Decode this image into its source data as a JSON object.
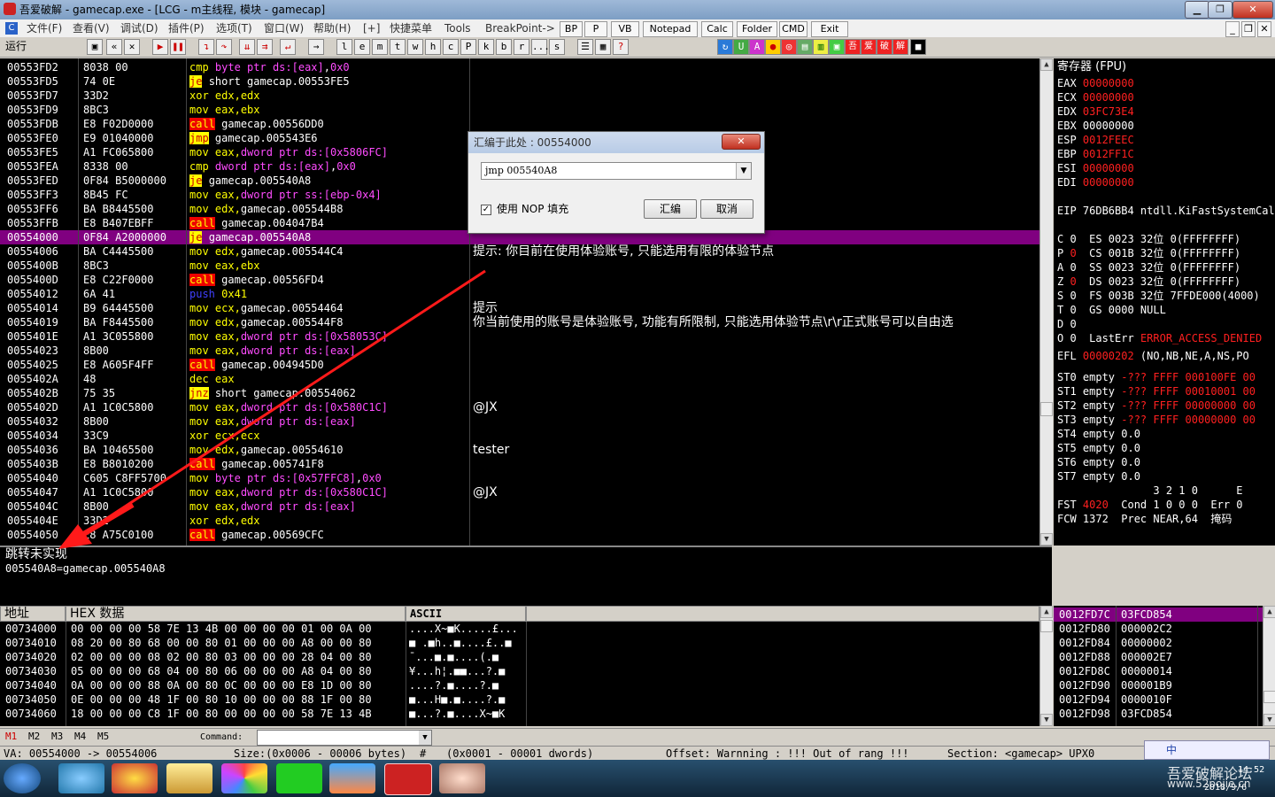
{
  "window": {
    "title": "吾爱破解 - gamecap.exe - [LCG - m主线程, 模块 - gamecap]",
    "minimize": "▁",
    "restore": "❐",
    "close": "✕"
  },
  "menu": {
    "items": [
      "文件(F)",
      "查看(V)",
      "调试(D)",
      "插件(P)",
      "选项(T)",
      "窗口(W)",
      "帮助(H)",
      "[+]",
      "快捷菜单",
      "Tools",
      "BreakPoint->"
    ],
    "buttons": [
      "BP",
      "P",
      "VB",
      "Notepad",
      "Calc",
      "Folder",
      "CMD",
      "Exit"
    ],
    "right_min": "_",
    "right_restore": "❐",
    "right_close": "✕"
  },
  "toolbar": {
    "status": "运行",
    "letters": [
      "l",
      "e",
      "m",
      "t",
      "w",
      "h",
      "c",
      "P",
      "k",
      "b",
      "r",
      "...",
      "s"
    ]
  },
  "disasm": {
    "selected_index": 12,
    "rows": [
      {
        "addr": "00553FD2",
        "hex": "8038 00",
        "mn": "cmp",
        "op": [
          [
            "byte ptr ds:[eax]",
            "mag"
          ],
          [
            ",",
            ""
          ],
          [
            "0x0",
            "imm"
          ]
        ]
      },
      {
        "addr": "00553FD5",
        "hex": "74 0E",
        "mn": "je",
        "op": [
          [
            "short gamecap.00553FE5",
            ""
          ]
        ]
      },
      {
        "addr": "00553FD7",
        "hex": "33D2",
        "mn": "xor",
        "op": [
          [
            "edx,edx",
            "kw"
          ]
        ]
      },
      {
        "addr": "00553FD9",
        "hex": "8BC3",
        "mn": "mov",
        "op": [
          [
            "eax,ebx",
            "kw"
          ]
        ]
      },
      {
        "addr": "00553FDB",
        "hex": "E8 F02D0000",
        "mn": "call",
        "op": [
          [
            "gamecap.00556DD0",
            ""
          ]
        ]
      },
      {
        "addr": "00553FE0",
        "hex": "E9 01040000",
        "mn": "jmp",
        "op": [
          [
            "gamecap.005543E6",
            ""
          ]
        ]
      },
      {
        "addr": "00553FE5",
        "hex": "A1 FC065800",
        "mn": "mov",
        "op": [
          [
            "eax,",
            "kw"
          ],
          [
            "dword ptr ds:[0x5806FC]",
            "mag"
          ]
        ]
      },
      {
        "addr": "00553FEA",
        "hex": "8338 00",
        "mn": "cmp",
        "op": [
          [
            "dword ptr ds:[eax]",
            "mag"
          ],
          [
            ",",
            ""
          ],
          [
            "0x0",
            "imm"
          ]
        ]
      },
      {
        "addr": "00553FED",
        "hex": "0F84 B5000000",
        "mn": "je",
        "op": [
          [
            "gamecap.005540A8",
            ""
          ]
        ]
      },
      {
        "addr": "00553FF3",
        "hex": "8B45 FC",
        "mn": "mov",
        "op": [
          [
            "eax,",
            "kw"
          ],
          [
            "dword ptr ss:[ebp-0x4]",
            "mag"
          ]
        ]
      },
      {
        "addr": "00553FF6",
        "hex": "BA B8445500",
        "mn": "mov",
        "op": [
          [
            "edx,",
            "kw"
          ],
          [
            "gamecap.005544B8",
            ""
          ]
        ]
      },
      {
        "addr": "00553FFB",
        "hex": "E8 B407EBFF",
        "mn": "call",
        "op": [
          [
            "gamecap.004047B4",
            ""
          ]
        ]
      },
      {
        "addr": "00554000",
        "hex": "0F84 A2000000",
        "mn": "je",
        "op": [
          [
            "gamecap.005540A8",
            ""
          ]
        ]
      },
      {
        "addr": "00554006",
        "hex": "BA C4445500",
        "mn": "mov",
        "op": [
          [
            "edx,",
            "kw"
          ],
          [
            "gamecap.005544C4",
            ""
          ]
        ]
      },
      {
        "addr": "0055400B",
        "hex": "8BC3",
        "mn": "mov",
        "op": [
          [
            "eax,ebx",
            "kw"
          ]
        ]
      },
      {
        "addr": "0055400D",
        "hex": "E8 C22F0000",
        "mn": "call",
        "op": [
          [
            "gamecap.00556FD4",
            ""
          ]
        ]
      },
      {
        "addr": "00554012",
        "hex": "6A 41",
        "mn": "push",
        "op": [
          [
            "0x41",
            "kw"
          ]
        ]
      },
      {
        "addr": "00554014",
        "hex": "B9 64445500",
        "mn": "mov",
        "op": [
          [
            "ecx,",
            "kw"
          ],
          [
            "gamecap.00554464",
            ""
          ]
        ]
      },
      {
        "addr": "00554019",
        "hex": "BA F8445500",
        "mn": "mov",
        "op": [
          [
            "edx,",
            "kw"
          ],
          [
            "gamecap.005544F8",
            ""
          ]
        ]
      },
      {
        "addr": "0055401E",
        "hex": "A1 3C055800",
        "mn": "mov",
        "op": [
          [
            "eax,",
            "kw"
          ],
          [
            "dword ptr ds:[0x58053C]",
            "mag"
          ]
        ]
      },
      {
        "addr": "00554023",
        "hex": "8B00",
        "mn": "mov",
        "op": [
          [
            "eax,",
            "kw"
          ],
          [
            "dword ptr ds:[eax]",
            "mag"
          ]
        ]
      },
      {
        "addr": "00554025",
        "hex": "E8 A605F4FF",
        "mn": "call",
        "op": [
          [
            "gamecap.004945D0",
            ""
          ]
        ]
      },
      {
        "addr": "0055402A",
        "hex": "48",
        "mn": "dec",
        "op": [
          [
            "eax",
            "kw"
          ]
        ]
      },
      {
        "addr": "0055402B",
        "hex": "75 35",
        "mn": "jnz",
        "op": [
          [
            "short gamecap.00554062",
            ""
          ]
        ]
      },
      {
        "addr": "0055402D",
        "hex": "A1 1C0C5800",
        "mn": "mov",
        "op": [
          [
            "eax,",
            "kw"
          ],
          [
            "dword ptr ds:[0x580C1C]",
            "mag"
          ]
        ]
      },
      {
        "addr": "00554032",
        "hex": "8B00",
        "mn": "mov",
        "op": [
          [
            "eax,",
            "kw"
          ],
          [
            "dword ptr ds:[eax]",
            "mag"
          ]
        ]
      },
      {
        "addr": "00554034",
        "hex": "33C9",
        "mn": "xor",
        "op": [
          [
            "ecx,ecx",
            "kw"
          ]
        ]
      },
      {
        "addr": "00554036",
        "hex": "BA 10465500",
        "mn": "mov",
        "op": [
          [
            "edx,",
            "kw"
          ],
          [
            "gamecap.00554610",
            ""
          ]
        ]
      },
      {
        "addr": "0055403B",
        "hex": "E8 B8010200",
        "mn": "call",
        "op": [
          [
            "gamecap.005741F8",
            ""
          ]
        ]
      },
      {
        "addr": "00554040",
        "hex": "C605 C8FF5700",
        "mn": "mov",
        "op": [
          [
            "byte ptr ds:[0x57FFC8]",
            "mag"
          ],
          [
            ",",
            ""
          ],
          [
            "0x0",
            "imm"
          ]
        ]
      },
      {
        "addr": "00554047",
        "hex": "A1 1C0C5800",
        "mn": "mov",
        "op": [
          [
            "eax,",
            "kw"
          ],
          [
            "dword ptr ds:[0x580C1C]",
            "mag"
          ]
        ]
      },
      {
        "addr": "0055404C",
        "hex": "8B00",
        "mn": "mov",
        "op": [
          [
            "eax,",
            "kw"
          ],
          [
            "dword ptr ds:[eax]",
            "mag"
          ]
        ]
      },
      {
        "addr": "0055404E",
        "hex": "33D2",
        "mn": "xor",
        "op": [
          [
            "edx,edx",
            "kw"
          ]
        ]
      },
      {
        "addr": "00554050",
        "hex": "E8 A75C0100",
        "mn": "call",
        "op": [
          [
            "gamecap.00569CFC",
            ""
          ]
        ]
      }
    ],
    "comments": [
      {
        "row": 13,
        "text": "提示: 你目前在使用体验账号, 只能选用有限的体验节点"
      },
      {
        "row": 17,
        "text": "提示"
      },
      {
        "row": 18,
        "text": "你当前使用的账号是体验账号, 功能有所限制, 只能选用体验节点\\r\\r正式账号可以自由选"
      },
      {
        "row": 24,
        "text": "@JX"
      },
      {
        "row": 27,
        "text": "tester"
      },
      {
        "row": 30,
        "text": "@JX"
      }
    ]
  },
  "info": {
    "line1": "跳转未实现",
    "line2": "005540A8=gamecap.005540A8"
  },
  "registers": {
    "title": "寄存器 (FPU)",
    "gp": [
      {
        "n": "EAX",
        "v": "00000000",
        "c": "red"
      },
      {
        "n": "ECX",
        "v": "00000000",
        "c": "red"
      },
      {
        "n": "EDX",
        "v": "03FC73E4",
        "c": "red"
      },
      {
        "n": "EBX",
        "v": "00000000",
        "c": ""
      },
      {
        "n": "ESP",
        "v": "0012FEEC",
        "c": "red"
      },
      {
        "n": "EBP",
        "v": "0012FF1C",
        "c": "red"
      },
      {
        "n": "ESI",
        "v": "00000000",
        "c": "red"
      },
      {
        "n": "EDI",
        "v": "00000000",
        "c": "red"
      }
    ],
    "eip": "EIP 76DB6BB4 ntdll.KiFastSystemCall",
    "flags": [
      {
        "f": "C 0",
        "s": "ES 0023 32位 0(FFFFFFFF)",
        "r": false
      },
      {
        "f": "P ",
        "v": "0",
        "s": "CS 001B 32位 0(FFFFFFFF)",
        "r": true
      },
      {
        "f": "A 0",
        "s": "SS 0023 32位 0(FFFFFFFF)",
        "r": false
      },
      {
        "f": "Z ",
        "v": "0",
        "s": "DS 0023 32位 0(FFFFFFFF)",
        "r": true
      },
      {
        "f": "S 0",
        "s": "FS 003B 32位 7FFDE000(4000)",
        "r": false
      },
      {
        "f": "T 0",
        "s": "GS 0000 NULL",
        "r": false
      },
      {
        "f": "D 0",
        "s": "",
        "r": false
      },
      {
        "f": "O 0",
        "s": "LastErr ",
        "e": "ERROR_ACCESS_DENIED",
        "r": false
      }
    ],
    "efl_label": "EFL",
    "efl_val": "00000202",
    "efl_rest": "(NO,NB,NE,A,NS,PO",
    "st": [
      {
        "n": "ST0",
        "t": "empty",
        "v": "-??? FFFF 000100FE 00",
        "red": true
      },
      {
        "n": "ST1",
        "t": "empty",
        "v": "-??? FFFF 00010001 00",
        "red": true
      },
      {
        "n": "ST2",
        "t": "empty",
        "v": "-??? FFFF 00000000 00",
        "red": true
      },
      {
        "n": "ST3",
        "t": "empty",
        "v": "-??? FFFF 00000000 00",
        "red": true
      },
      {
        "n": "ST4",
        "t": "empty",
        "v": "0.0",
        "red": false
      },
      {
        "n": "ST5",
        "t": "empty",
        "v": "0.0",
        "red": false
      },
      {
        "n": "ST6",
        "t": "empty",
        "v": "0.0",
        "red": false
      },
      {
        "n": "ST7",
        "t": "empty",
        "v": "0.0",
        "red": false
      }
    ],
    "fpu_hdr": "               3 2 1 0      E",
    "fst_label": "FST",
    "fst_val": "4020",
    "fst_rest": "  Cond 1 0 0 0  Err 0",
    "fcw": "FCW 1372  Prec NEAR,64  掩码"
  },
  "dump": {
    "header_addr": "地址",
    "header_hex": "HEX 数据",
    "header_ascii": "ASCII",
    "rows": [
      {
        "a": "00734000",
        "h": "00 00 00 00 58 7E 13 4B 00 00 00 00 01 00 0A 00",
        "s": "....X~■K.....£..."
      },
      {
        "a": "00734010",
        "h": "08 20 00 80 68 00 00 80 01 00 00 00 A8 00 00 80",
        "s": "■ .■h..■....£..■"
      },
      {
        "a": "00734020",
        "h": "02 00 00 00 08 02 00 80 03 00 00 00 28 04 00 80",
        "s": "¯...■.■....(.■"
      },
      {
        "a": "00734030",
        "h": "05 00 00 00 68 04 00 80 06 00 00 00 A8 04 00 80",
        "s": "¥...h¦.■■...?.■"
      },
      {
        "a": "00734040",
        "h": "0A 00 00 00 88 0A 00 80 0C 00 00 00 E8 1D 00 80",
        "s": "....?.■....?.■"
      },
      {
        "a": "00734050",
        "h": "0E 00 00 00 48 1F 00 80 10 00 00 00 88 1F 00 80",
        "s": "■...H■.■....?.■"
      },
      {
        "a": "00734060",
        "h": "18 00 00 00 C8 1F 00 80 00 00 00 00 58 7E 13 4B",
        "s": "■...?.■....X~■K"
      }
    ]
  },
  "stack": {
    "rows": [
      {
        "a": "0012FD7C",
        "v": "03FCD854"
      },
      {
        "a": "0012FD80",
        "v": "000002C2"
      },
      {
        "a": "0012FD84",
        "v": "00000002"
      },
      {
        "a": "0012FD88",
        "v": "000002E7"
      },
      {
        "a": "0012FD8C",
        "v": "00000014"
      },
      {
        "a": "0012FD90",
        "v": "000001B9"
      },
      {
        "a": "0012FD94",
        "v": "0000010F"
      },
      {
        "a": "0012FD98",
        "v": "03FCD854"
      }
    ]
  },
  "command": {
    "tabs": [
      "M1",
      "M2",
      "M3",
      "M4",
      "M5"
    ],
    "label": "Command:"
  },
  "status": {
    "va": "VA: 00554000 -> 00554006",
    "size": "Size:(0x0006 - 00006 bytes)",
    "hash": "#",
    "dwords": "(0x0001 - 00001 dwords)",
    "offset": "Offset: Warnning : !!! Out of rang !!!",
    "section": "Section: <gamecap> UPX0"
  },
  "dialog": {
    "title": "汇编于此处 : 00554000",
    "input": "jmp 005540A8",
    "nop_label": "使用 NOP 填充",
    "ok": "汇编",
    "cancel": "取消"
  },
  "taskbar": {
    "time": "14:52",
    "date": "2018/9/6",
    "watermark": "吾爱破解论坛",
    "watermark_url": "www.52pojie.cn",
    "ime": "中"
  },
  "colors": {
    "selection": "#800080",
    "red": "#ff2020",
    "yellow": "#ffff00",
    "magenta": "#ff4cff"
  }
}
